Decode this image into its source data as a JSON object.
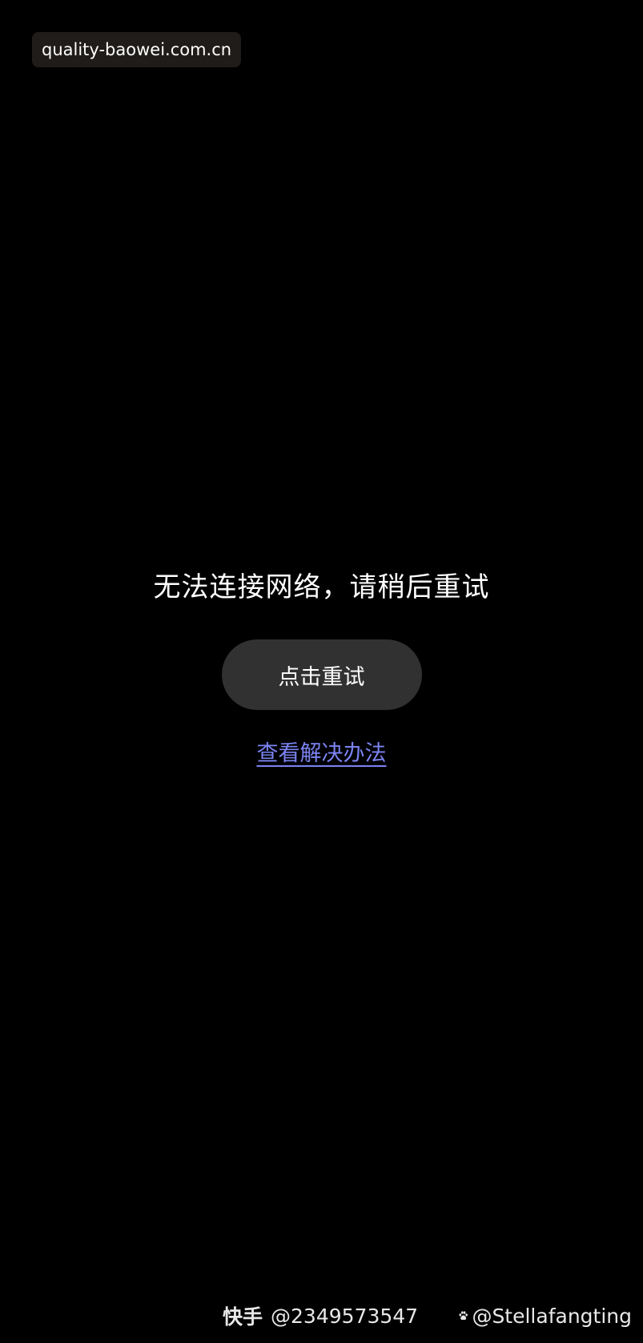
{
  "source_badge": {
    "text": "quality-baowei.com.cn"
  },
  "error_screen": {
    "message": "无法连接网络，请稍后重试",
    "retry_button_label": "点击重试",
    "solution_link_label": "查看解决办法"
  },
  "watermarks": {
    "kuaishou_brand": "快手",
    "kuaishou_id": "@2349573547",
    "weibo_handle": "@Stellafangting",
    "weibo_icon": "paw-icon"
  },
  "colors": {
    "background": "#000000",
    "button_bg": "#313131",
    "link": "#7b83f2"
  }
}
